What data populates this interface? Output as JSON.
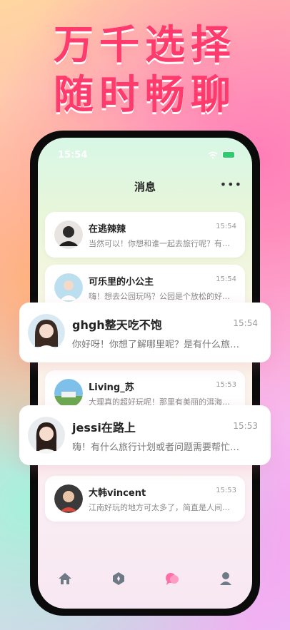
{
  "promo": {
    "line1": "万千选择",
    "line2": "随时畅聊"
  },
  "status": {
    "time": "15:54"
  },
  "header": {
    "title": "消息",
    "more": "•••"
  },
  "conversations": [
    {
      "name": "在逃辣辣",
      "time": "15:54",
      "message": "当然可以！你想和谁一起去旅行呢？有…"
    },
    {
      "name": "可乐里的小公主",
      "time": "15:54",
      "message": "嗨！想去公园玩吗？公园是个放松的好…"
    },
    {
      "name": "ghgh整天吃不饱",
      "time": "15:54",
      "message": "你好呀！你想了解哪里呢？是有什么旅…"
    },
    {
      "name": "Living_苏",
      "time": "15:53",
      "message": "大理真的超好玩呢！那里有美丽的洱海…"
    },
    {
      "name": "jessi在路上",
      "time": "15:53",
      "message": "嗨！有什么旅行计划或者问题需要帮忙…"
    },
    {
      "name": "大韩vincent",
      "time": "15:53",
      "message": "江南好玩的地方可太多了，简直是人间…"
    }
  ],
  "tabs": [
    {
      "icon": "home-icon"
    },
    {
      "icon": "discover-icon"
    },
    {
      "icon": "messages-icon",
      "active": true
    },
    {
      "icon": "profile-icon"
    }
  ],
  "colors": {
    "headline": "#ff3b6d",
    "active_tab": "#ff6fa8",
    "inactive_tab": "#6e7a86"
  }
}
